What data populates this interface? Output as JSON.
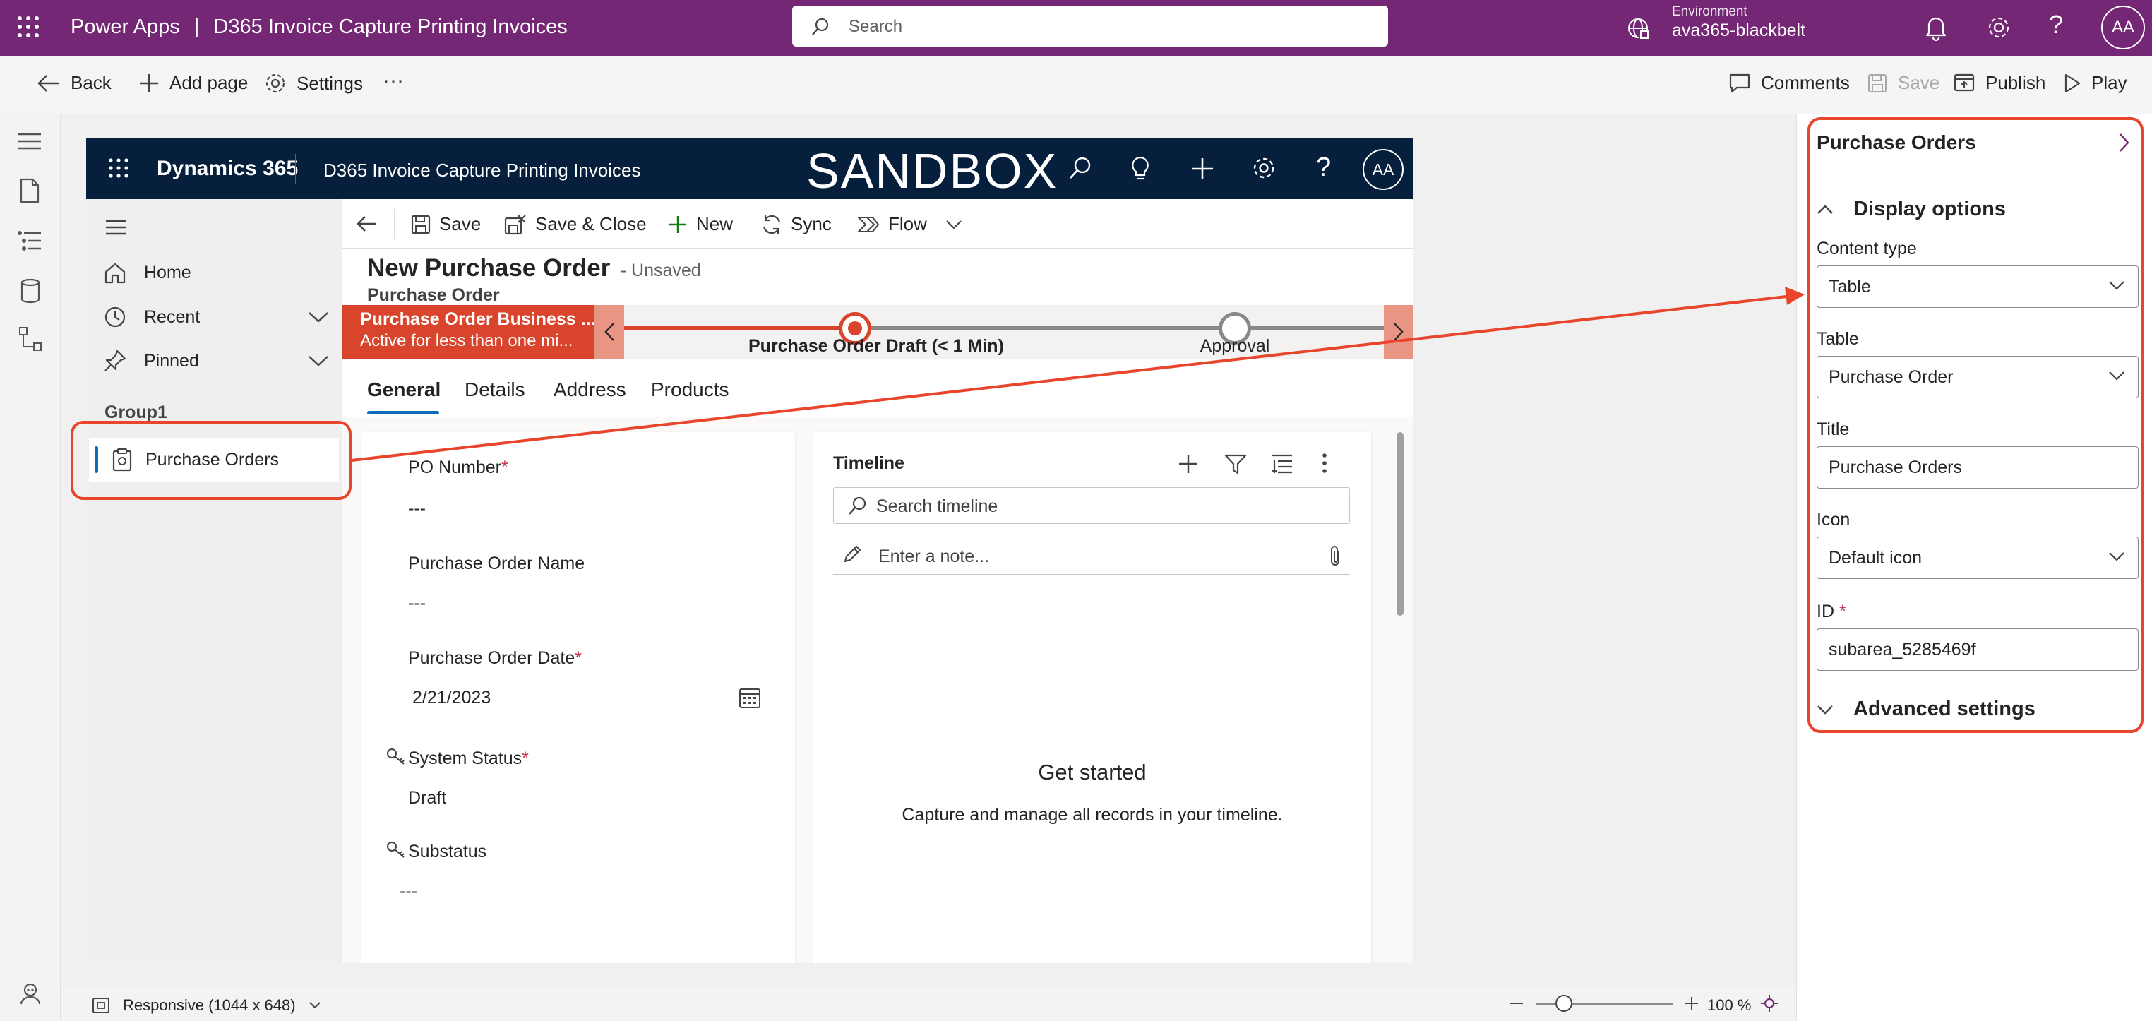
{
  "topbar": {
    "product": "Power Apps",
    "separator": "|",
    "app_title": "D365 Invoice Capture Printing Invoices",
    "search_placeholder": "Search",
    "env_label": "Environment",
    "env_value": "ava365-blackbelt",
    "avatar": "AA"
  },
  "cmdbar": {
    "back": "Back",
    "add_page": "Add page",
    "settings": "Settings",
    "more": "···",
    "comments": "Comments",
    "save": "Save",
    "publish": "Publish",
    "play": "Play"
  },
  "app": {
    "brand": "Dynamics 365",
    "name": "D365 Invoice Capture Printing Invoices",
    "banner": "SANDBOX",
    "avatar": "AA",
    "sitemap": {
      "home": "Home",
      "recent": "Recent",
      "pinned": "Pinned",
      "group": "Group1",
      "selected": "Purchase Orders"
    },
    "form_cmd": {
      "save": "Save",
      "save_close": "Save & Close",
      "new": "New",
      "sync": "Sync",
      "flow": "Flow"
    },
    "header": {
      "title": "New Purchase Order",
      "status": "- Unsaved",
      "entity": "Purchase Order"
    },
    "bpf": {
      "name": "Purchase Order Business ...",
      "duration": "Active for less than one mi...",
      "stage1": "Purchase Order Draft  (< 1 Min)",
      "stage2": "Approval"
    },
    "tabs": [
      "General",
      "Details",
      "Address",
      "Products"
    ],
    "fields": {
      "po_number_label": "PO Number",
      "po_number_value": "---",
      "po_name_label": "Purchase Order Name",
      "po_name_value": "---",
      "po_date_label": "Purchase Order Date",
      "po_date_value": "2/21/2023",
      "system_status_label": "System Status",
      "system_status_value": "Draft",
      "substatus_label": "Substatus",
      "substatus_value": "---",
      "required_mark": "*"
    },
    "timeline": {
      "title": "Timeline",
      "search_placeholder": "Search timeline",
      "note_placeholder": "Enter a note...",
      "empty_title": "Get started",
      "empty_text": "Capture and manage all records in your timeline."
    }
  },
  "panel": {
    "title": "Purchase Orders",
    "display_options": "Display options",
    "content_type_label": "Content type",
    "content_type_value": "Table",
    "table_label": "Table",
    "table_value": "Purchase Order",
    "title_label": "Title",
    "title_value": "Purchase Orders",
    "icon_label": "Icon",
    "icon_value": "Default icon",
    "id_label": "ID",
    "id_required": "*",
    "id_value": "subarea_5285469f",
    "advanced": "Advanced settings"
  },
  "statusbar": {
    "responsive": "Responsive (1044 x 648)",
    "zoom": "100 %",
    "zoom_fraction": 0.16
  },
  "colors": {
    "powerapps_purple": "#742774",
    "d365_navy": "#061f3c",
    "highlight_red": "#e8452c",
    "bpf_active": "#d9442c",
    "selected_bar": "#0f6cbd"
  }
}
